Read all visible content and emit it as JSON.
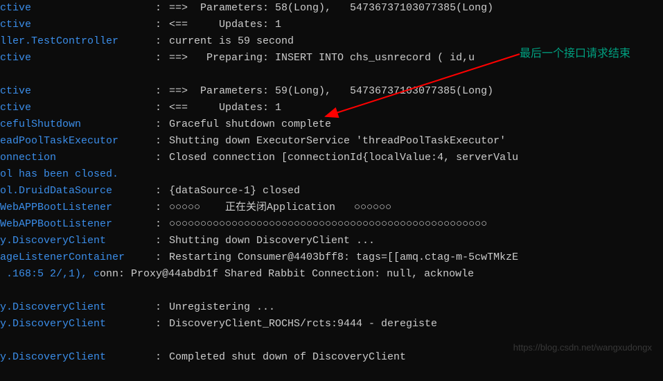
{
  "annotation": {
    "text": "最后一个接口请求结束"
  },
  "watermark": "https://blog.csdn.net/wangxudongx",
  "lines": [
    {
      "loc": "ctive",
      "sep": ":",
      "msg": "==>  Parameters: 58(Long),   ‎54736737103077385(Long)"
    },
    {
      "loc": "ctive",
      "sep": ":",
      "msg": "<==     Updates: 1"
    },
    {
      "loc": "ller.TestController",
      "sep": ":",
      "msg": "current is 59 second"
    },
    {
      "loc": "ctive",
      "sep": ":",
      "msg": "==>   Preparing: INSERT INTO ch‎‎‎s_us‎‎‎‎nrecord ( id,u"
    },
    {
      "loc": "",
      "sep": "",
      "msg": ""
    },
    {
      "loc": "ctive",
      "sep": ":",
      "msg": "==>  Parameters: 59(Long),   ‎54736737103077385(Long)"
    },
    {
      "loc": "ctive",
      "sep": ":",
      "msg": "<==     Updates: 1"
    },
    {
      "loc": "cefulShutdown",
      "sep": ":",
      "msg": "Graceful shutdown complete"
    },
    {
      "loc": "eadPoolTaskExecutor",
      "sep": ":",
      "msg": "Shutting down ExecutorService 'threadPoolTaskExecutor'"
    },
    {
      "loc": "onnection",
      "sep": ":",
      "msg": "Closed connection [connectionId{localValue:4, serverValu"
    },
    {
      "loc": "ol has been closed.",
      "sep": "",
      "msg": ""
    },
    {
      "loc": "ol.DruidDataSource",
      "sep": ":",
      "msg": "{dataSource-1} closed"
    },
    {
      "loc": "WebAPPBootListener",
      "sep": ":",
      "msg": "○○○○○    正在关闭Application   ○○○○○○"
    },
    {
      "loc": "WebAPPBootListener",
      "sep": ":",
      "msg": "○○○○○○○○○○○○○○○○○○○○○○○○○○○○○○○○○○○○○○○○○○○○○○○○○○○"
    },
    {
      "loc": "y.DiscoveryClient",
      "sep": ":",
      "msg": "Shutting down DiscoveryClient ..."
    },
    {
      "loc": "ageListenerContainer",
      "sep": ":",
      "msg": "Restarting Consumer@4403bff8: tags=[[amq.ctag-m-5cwTMkzE"
    },
    {
      "loc": "‎‎ .168:5‎ ‎2/,1), conn: Proxy@44abdb1f Shared Rabbit Connection: null, acknowle",
      "sep": "",
      "msg": "",
      "full": true
    },
    {
      "loc": "",
      "sep": "",
      "msg": ""
    },
    {
      "loc": "y.DiscoveryClient",
      "sep": ":",
      "msg": "Unregistering ..."
    },
    {
      "loc": "y.DiscoveryClient",
      "sep": ":",
      "msg": "DiscoveryClient_RO‎‎‎CH‎‎S/rc‎‎‎‎‎‎ts:9444 - deregiste"
    },
    {
      "loc": "",
      "sep": "",
      "msg": ""
    },
    {
      "loc": "y.DiscoveryClient",
      "sep": ":",
      "msg": "Completed shut down of DiscoveryClient"
    }
  ]
}
